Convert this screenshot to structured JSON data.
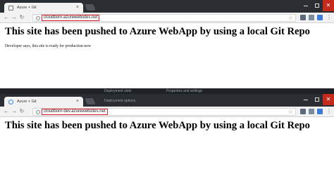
{
  "window1": {
    "tab_title": "Azure + Git",
    "url": "cloudborn.azurewebsites.net",
    "heading": "This site has been pushed to Azure WebApp by using a local Git Repo",
    "paragraph": "Developer says, this site is ready for production now"
  },
  "window2": {
    "tab_title": "Azure + Git",
    "url": "cloudborn-dev.azurewebsites.net",
    "heading": "This site has been pushed to Azure WebApp by using a local Git Repo"
  },
  "background": {
    "items": [
      "Deployment slots",
      "Properties and settings",
      "Deployment options"
    ]
  },
  "icons": {
    "back": "back-arrow-icon",
    "forward": "forward-arrow-icon",
    "reload": "reload-icon",
    "home": "home-icon",
    "info": "info-icon",
    "star": "star-icon",
    "menu": "menu-dots-icon"
  },
  "colors": {
    "url_highlight": "#e0202a",
    "titlebar": "#2a2d31",
    "close_button": "#c42b1c"
  }
}
